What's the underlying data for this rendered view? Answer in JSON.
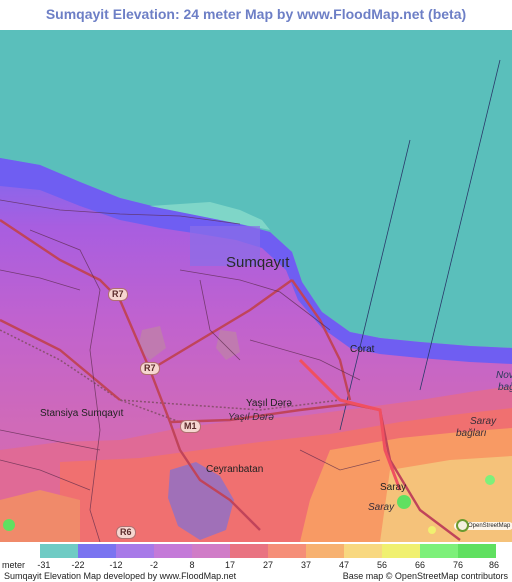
{
  "title": "Sumqayit Elevation: 24 meter Map by www.FloodMap.net (beta)",
  "map": {
    "place_labels": {
      "city": "Sumqayıt",
      "corat": "Corat",
      "stansiya": "Stansiya Sumqayıt",
      "yasil_dara": "Yaşıl Dərə",
      "yasil_dara_italic": "Yaşıl Dərə",
      "ceyranbatan": "Ceyranbatan",
      "saray": "Saray",
      "saray_italic": "Saray",
      "saray_baglari": "Saray",
      "saray_baglari_2": "bağları",
      "nov_edge": "Nov",
      "bag_edge": "bağ"
    },
    "road_shields": {
      "r7_north": "R7",
      "r7_south": "R7",
      "m1": "M1",
      "r6": "R6"
    },
    "colors": {
      "sea": "#5abfbb",
      "low_blue": "#7b6af0",
      "purple": "#b45ed4",
      "magenta": "#d070c0",
      "pink": "#e05a8c",
      "red": "#f0706a",
      "orange": "#f89a64",
      "yellow": "#f5d27a",
      "green": "#60e060"
    }
  },
  "legend": {
    "unit_label": "meter",
    "ticks": [
      "-31",
      "-22",
      "-12",
      "-2",
      "8",
      "17",
      "27",
      "37",
      "47",
      "56",
      "66",
      "76",
      "86"
    ],
    "colors": [
      "#6fcbc4",
      "#7a74f0",
      "#a77ae8",
      "#c47ad8",
      "#d07cc7",
      "#e97381",
      "#f58e78",
      "#f7b170",
      "#f8d880",
      "#f0f070",
      "#7df07a",
      "#60e060"
    ],
    "credit_left": "Sumqayit Elevation Map developed by www.FloodMap.net",
    "credit_right": "Base map © OpenStreetMap contributors"
  },
  "osm_badge": "OpenStreetMap"
}
